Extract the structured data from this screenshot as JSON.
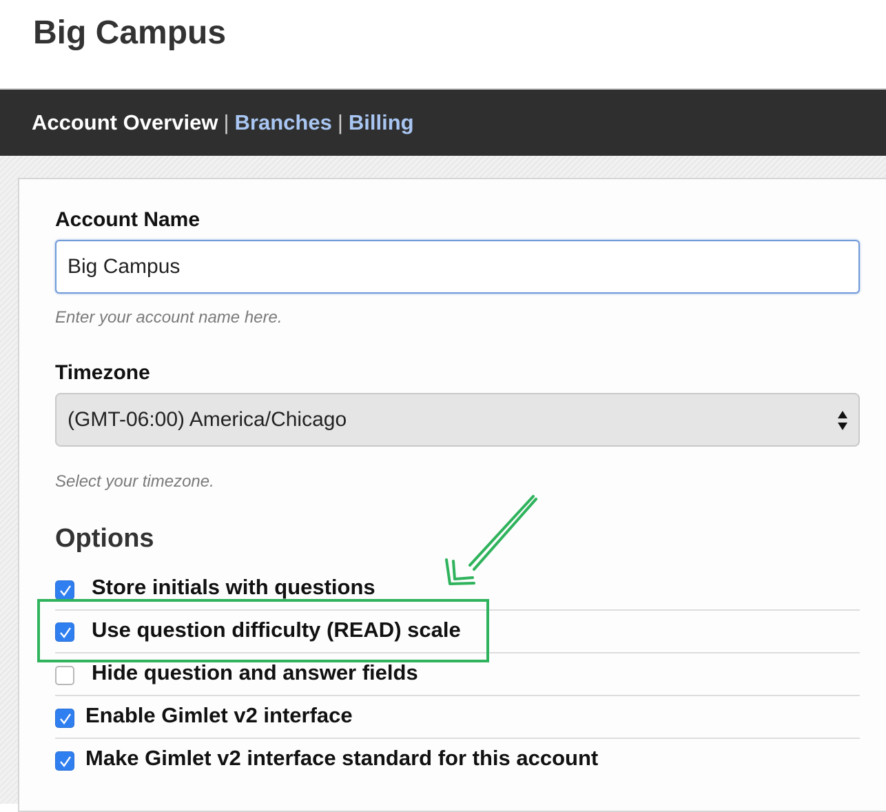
{
  "header": {
    "title": "Big Campus"
  },
  "nav": {
    "current": "Account Overview",
    "separator": "|",
    "links": [
      "Branches",
      "Billing"
    ]
  },
  "form": {
    "account_name": {
      "label": "Account Name",
      "value": "Big Campus",
      "help": "Enter your account name here."
    },
    "timezone": {
      "label": "Timezone",
      "value": "(GMT-06:00) America/Chicago",
      "help": "Select your timezone."
    }
  },
  "options": {
    "heading": "Options",
    "items": [
      {
        "label": "Store initials with questions",
        "checked": true
      },
      {
        "label": "Use question difficulty (READ) scale",
        "checked": true
      },
      {
        "label": "Hide question and answer fields",
        "checked": false
      },
      {
        "label": "Enable Gimlet v2 interface",
        "checked": true
      },
      {
        "label": "Make Gimlet v2 interface standard for this account",
        "checked": true
      }
    ]
  },
  "annotation": {
    "color": "#2fb35c",
    "highlighted_option": "Use question difficulty (READ) scale"
  },
  "colors": {
    "navbar": "#2f2f2f",
    "link": "#a9c6f2",
    "checkbox_accent": "#2f7ff0"
  }
}
